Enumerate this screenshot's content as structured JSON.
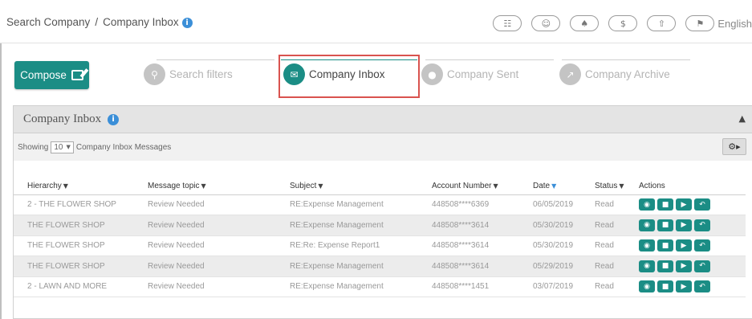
{
  "header": {
    "breadcrumb": [
      "Search Company",
      "Company Inbox"
    ],
    "breadcrumb_sep": "/",
    "info_glyph": "i",
    "icons": [
      {
        "name": "list-icon",
        "glyph": "☷"
      },
      {
        "name": "user-icon",
        "glyph": "☺"
      },
      {
        "name": "bell-icon",
        "glyph": "♠"
      },
      {
        "name": "dollar-icon",
        "glyph": "$"
      },
      {
        "name": "upload-icon",
        "glyph": "⇧"
      }
    ],
    "language": {
      "flag_icon": "flag-icon",
      "flag_glyph": "⚑",
      "label": "English"
    }
  },
  "compose": {
    "label": "Compose",
    "icon": "edit-icon"
  },
  "steps": [
    {
      "label": "Search filters",
      "icon": "search-icon",
      "glyph": "⚲",
      "active": false
    },
    {
      "label": "Company Inbox",
      "icon": "envelope-icon",
      "glyph": "✉",
      "active": true
    },
    {
      "label": "Company Sent",
      "icon": "users-icon",
      "glyph": "●",
      "active": false
    },
    {
      "label": "Company Archive",
      "icon": "share-icon",
      "glyph": "↗",
      "active": false
    }
  ],
  "panel": {
    "title": "Company Inbox",
    "collapse_glyph": "▲",
    "showing_prefix": "Showing",
    "page_size": "10",
    "select_caret": "▼",
    "showing_suffix": "Company Inbox Messages",
    "settings_glyph": "⚙▸"
  },
  "table": {
    "columns": [
      {
        "label": "Hierarchy",
        "caret": "▼",
        "active": false
      },
      {
        "label": "Message topic",
        "caret": "▼",
        "active": false
      },
      {
        "label": "Subject",
        "caret": "▼",
        "active": false
      },
      {
        "label": "Account Number",
        "caret": "▼",
        "active": false
      },
      {
        "label": "Date",
        "caret": "▼",
        "active": true
      },
      {
        "label": "Status",
        "caret": "▼",
        "active": false
      },
      {
        "label": "Actions",
        "caret": "",
        "active": false
      }
    ],
    "rows": [
      {
        "hierarchy": "2 - THE FLOWER SHOP",
        "topic": "Review Needed",
        "subject": "RE:Expense Management",
        "account": "448508****6369",
        "date": "06/05/2019",
        "status": "Read"
      },
      {
        "hierarchy": "THE FLOWER SHOP",
        "topic": "Review Needed",
        "subject": "RE:Expense Management",
        "account": "448508****3614",
        "date": "05/30/2019",
        "status": "Read"
      },
      {
        "hierarchy": "THE FLOWER SHOP",
        "topic": "Review Needed",
        "subject": "RE:Re: Expense Report1",
        "account": "448508****3614",
        "date": "05/30/2019",
        "status": "Read"
      },
      {
        "hierarchy": "THE FLOWER SHOP",
        "topic": "Review Needed",
        "subject": "RE:Expense Management",
        "account": "448508****3614",
        "date": "05/29/2019",
        "status": "Read"
      },
      {
        "hierarchy": "2 - LAWN AND MORE",
        "topic": "Review Needed",
        "subject": "RE:Expense Management",
        "account": "448508****1451",
        "date": "03/07/2019",
        "status": "Read"
      }
    ],
    "row_actions": [
      {
        "name": "view-icon",
        "glyph": "◉"
      },
      {
        "name": "delete-icon",
        "glyph": "■"
      },
      {
        "name": "tag-icon",
        "glyph": "▶"
      },
      {
        "name": "reply-icon",
        "glyph": "↶"
      }
    ]
  },
  "colors": {
    "accent": "#1b8d85",
    "info": "#3b8fd8",
    "highlight": "#d9534f"
  }
}
